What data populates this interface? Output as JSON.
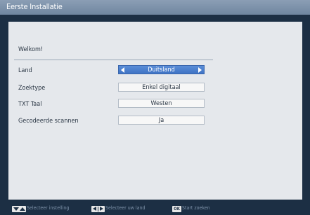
{
  "window": {
    "title": "Eerste Installatie"
  },
  "panel": {
    "welcome": "Welkom!",
    "rows": [
      {
        "label": "Land",
        "value": "Duitsland",
        "selected": true
      },
      {
        "label": "Zoektype",
        "value": "Enkel digitaal",
        "selected": false
      },
      {
        "label": "TXT Taal",
        "value": "Westen",
        "selected": false
      },
      {
        "label": "Gecodeerde scannen",
        "value": "Ja",
        "selected": false
      }
    ]
  },
  "footer": {
    "hints": [
      {
        "key_icon": "up-down-arrows-icon",
        "text": "Selecteer instelling"
      },
      {
        "key_icon": "left-right-arrows-icon",
        "text": "Selecteer uw land"
      },
      {
        "key_icon": "ok-key-icon",
        "key_label": "OK",
        "text": "Start zoeken"
      }
    ]
  },
  "colors": {
    "background": "#1c2f44",
    "title_bar": "#7f94ad",
    "panel": "#e5e8ec",
    "selected_field": "#4a7fcf"
  }
}
